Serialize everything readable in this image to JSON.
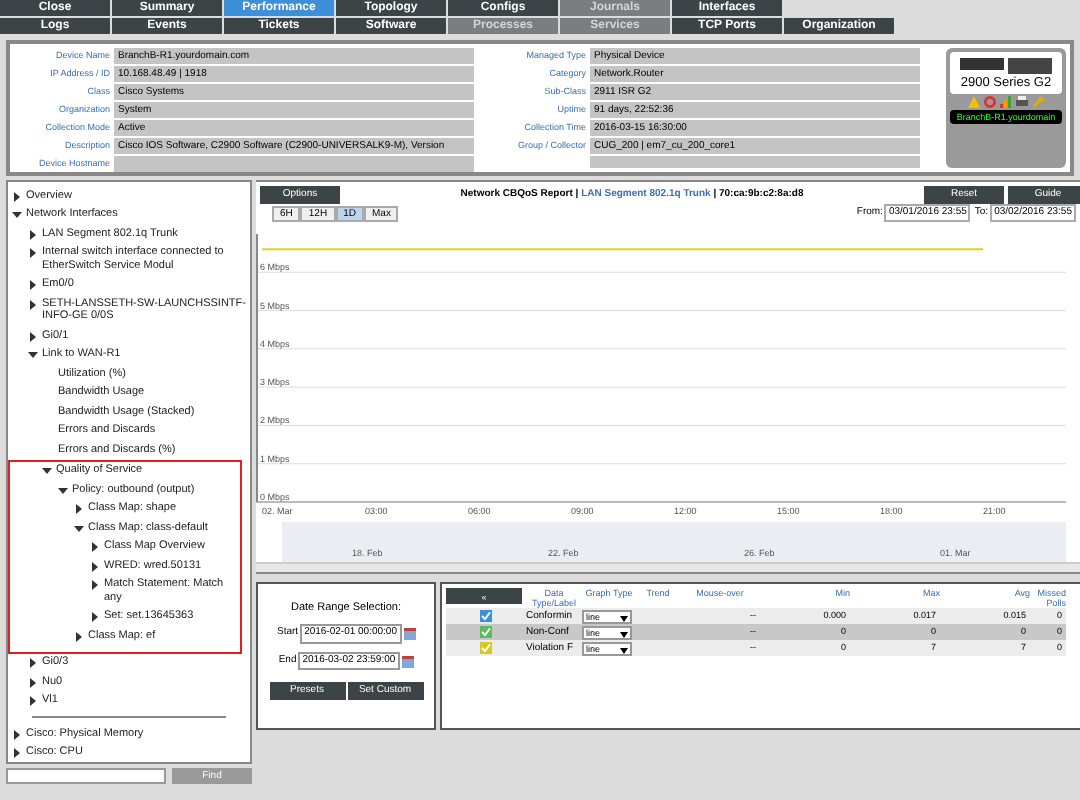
{
  "nav_rows": [
    [
      {
        "label": "Close",
        "selected": false,
        "disabled": false
      },
      {
        "label": "Summary",
        "selected": false,
        "disabled": false
      },
      {
        "label": "Performance",
        "selected": true,
        "disabled": false
      },
      {
        "label": "Topology",
        "selected": false,
        "disabled": false
      },
      {
        "label": "Configs",
        "selected": false,
        "disabled": false
      },
      {
        "label": "Journals",
        "selected": false,
        "disabled": true
      },
      {
        "label": "Interfaces",
        "selected": false,
        "disabled": false
      }
    ],
    [
      {
        "label": "Logs",
        "selected": false,
        "disabled": false
      },
      {
        "label": "Events",
        "selected": false,
        "disabled": false
      },
      {
        "label": "Tickets",
        "selected": false,
        "disabled": false
      },
      {
        "label": "Software",
        "selected": false,
        "disabled": false
      },
      {
        "label": "Processes",
        "selected": false,
        "disabled": true
      },
      {
        "label": "Services",
        "selected": false,
        "disabled": true
      },
      {
        "label": "TCP Ports",
        "selected": false,
        "disabled": false
      },
      {
        "label": "Organization",
        "selected": false,
        "disabled": false
      }
    ]
  ],
  "device_info": {
    "left": [
      {
        "label": "Device Name",
        "value": "BranchB-R1.yourdomain.com"
      },
      {
        "label": "IP Address / ID",
        "value": "10.168.48.49 | 1918"
      },
      {
        "label": "Class",
        "value": "Cisco Systems"
      },
      {
        "label": "Organization",
        "value": "System"
      },
      {
        "label": "Collection Mode",
        "value": "Active"
      },
      {
        "label": "Description",
        "value": "Cisco IOS Software, C2900 Software (C2900-UNIVERSALK9-M), Version"
      },
      {
        "label": "Device Hostname"
      }
    ],
    "right": [
      {
        "label": "Managed Type",
        "value": "Physical Device"
      },
      {
        "label": "Category",
        "value": "Network.Router"
      },
      {
        "label": "Sub-Class",
        "value": "2911 ISR G2"
      },
      {
        "label": "Uptime",
        "value": "91 days, 22:52:36"
      },
      {
        "label": "Collection Time",
        "value": "2016-03-15 16:30:00"
      },
      {
        "label": "Group / Collector",
        "value": "CUG_200 | em7_cu_200_core1"
      }
    ],
    "model": "2900 Series G2",
    "device_label": "BranchB-R1.yourdomain"
  },
  "tree": [
    {
      "label": "Overview",
      "expanded": false
    },
    {
      "label": "Network Interfaces",
      "expanded": true,
      "children": [
        {
          "label": "LAN Segment 802.1q Trunk",
          "expanded": false
        },
        {
          "label": "Internal switch interface connected to EtherSwitch Service Modul",
          "expanded": false
        },
        {
          "label": "Em0/0",
          "expanded": false
        },
        {
          "label": "SETH-LANSSETH-SW-LAUNCHSSINTF-INFO-GE 0/0S",
          "expanded": false
        },
        {
          "label": "Gi0/1",
          "expanded": false
        },
        {
          "label": "Link to WAN-R1",
          "expanded": true,
          "children": [
            {
              "label": "Utilization (%)"
            },
            {
              "label": "Bandwidth Usage"
            },
            {
              "label": "Bandwidth Usage (Stacked)"
            },
            {
              "label": "Errors and Discards"
            },
            {
              "label": "Errors and Discards (%)"
            },
            {
              "label": "Quality of Service",
              "expanded": true,
              "highlighted": true,
              "children": [
                {
                  "label": "Policy: outbound (output)",
                  "expanded": true,
                  "children": [
                    {
                      "label": "Class Map: shape",
                      "expanded": false
                    },
                    {
                      "label": "Class Map: class-default",
                      "expanded": true,
                      "children": [
                        {
                          "label": "Class Map Overview",
                          "expanded": false
                        },
                        {
                          "label": "WRED: wred.50131",
                          "expanded": false
                        },
                        {
                          "label": "Match Statement: Match any",
                          "expanded": false
                        },
                        {
                          "label": "Set: set.13645363",
                          "expanded": false
                        }
                      ]
                    },
                    {
                      "label": "Class Map: ef",
                      "expanded": false
                    }
                  ]
                }
              ]
            }
          ]
        },
        {
          "label": "Gi0/3",
          "expanded": false
        },
        {
          "label": "Nu0",
          "expanded": false
        },
        {
          "label": "Vl1",
          "expanded": false
        }
      ]
    }
  ],
  "tree_bottom": [
    {
      "label": "Cisco: Physical Memory",
      "expanded": false
    },
    {
      "label": "Cisco: CPU",
      "expanded": false
    }
  ],
  "find_button": "Find",
  "report": {
    "options_button": "Options",
    "title": "Network CBQoS Report | ",
    "link": "LAN Segment 802.1q Trunk",
    "suffix": " | 70:ca:9b:c2:8a:d8",
    "reset_button": "Reset",
    "guide_button": "Guide",
    "zoom_buttons": [
      {
        "label": "6H",
        "selected": false
      },
      {
        "label": "12H",
        "selected": false
      },
      {
        "label": "1D",
        "selected": true
      },
      {
        "label": "Max",
        "selected": false
      }
    ],
    "from_label": "From:",
    "from_value": "03/01/2016 23:55",
    "to_label": "To:",
    "to_value": "03/02/2016 23:55",
    "chart_data": {
      "type": "line",
      "categories": [
        "02. Mar",
        "03:00",
        "06:00",
        "09:00",
        "12:00",
        "15:00",
        "18:00",
        "21:00"
      ],
      "series": [
        {
          "color": "#e0d020",
          "values": [
            6.6,
            6.6,
            6.6,
            6.6,
            6.6,
            6.6,
            6.6,
            6.6
          ]
        }
      ],
      "grid": true,
      "ylim": [
        0,
        7
      ],
      "yticks": [
        {
          "value": 0,
          "label": "0 Mbps"
        },
        {
          "value": 1,
          "label": "1 Mbps"
        },
        {
          "value": 2,
          "label": "2 Mbps"
        },
        {
          "value": 3,
          "label": "3 Mbps"
        },
        {
          "value": 4,
          "label": "4 Mbps"
        },
        {
          "value": 5,
          "label": "5 Mbps"
        },
        {
          "value": 6,
          "label": "6 Mbps"
        }
      ]
    },
    "navigator_labels": [
      "18. Feb",
      "22. Feb",
      "26. Feb",
      "01. Mar"
    ]
  },
  "date_range": {
    "title": "Date Range Selection:",
    "start_label": "Start",
    "start_value": "2016-02-01 00:00:00",
    "end_label": "End",
    "end_value": "2016-03-02 23:59:00",
    "buttons": [
      "Presets",
      "Set Custom"
    ]
  },
  "legend": {
    "collapse_button": "«",
    "columns": [
      "Data Type/Label",
      "Graph Type",
      "Trend",
      "Mouse-over",
      "Min",
      "Max",
      "Avg",
      "Missed Polls"
    ],
    "rows": [
      {
        "checked": true,
        "color": "#3a8fd8",
        "label": "Conformin",
        "graph_type": "line",
        "mouse_over": "--",
        "min": "0.000",
        "max": "0.017",
        "avg": "0.015",
        "missed": "0"
      },
      {
        "checked": true,
        "color": "#5cb85c",
        "label": "Non-Conf",
        "graph_type": "line",
        "mouse_over": "--",
        "min": "0",
        "max": "0",
        "avg": "0",
        "missed": "0"
      },
      {
        "checked": true,
        "color": "#d8c820",
        "label": "Violation F",
        "graph_type": "line",
        "mouse_over": "--",
        "min": "0",
        "max": "7",
        "avg": "7",
        "missed": "0"
      }
    ]
  }
}
